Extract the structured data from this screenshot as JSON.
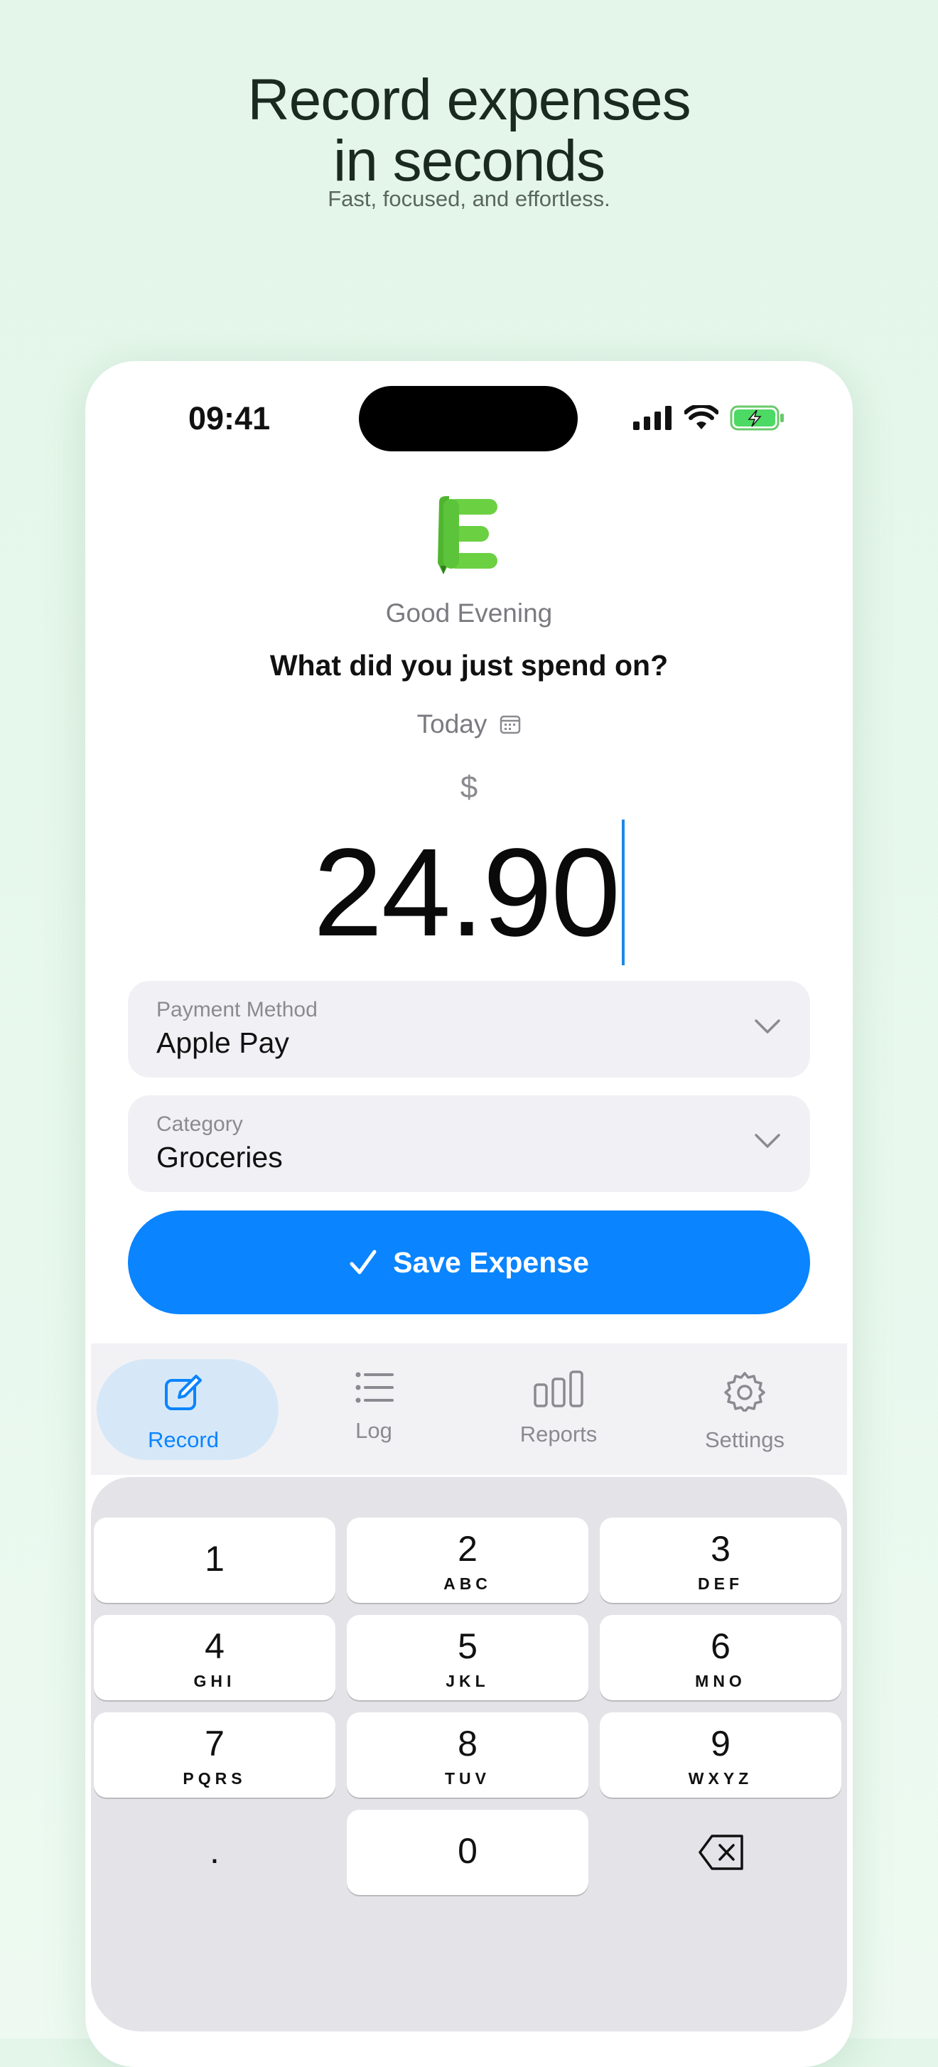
{
  "promo": {
    "headline_line1": "Record expenses",
    "headline_line2": "in seconds",
    "subheadline": "Fast, focused, and effortless."
  },
  "status_bar": {
    "time": "09:41"
  },
  "app": {
    "greeting": "Good Evening",
    "question": "What did you just spend on?",
    "date_label": "Today",
    "currency_symbol": "$",
    "amount": "24.90"
  },
  "fields": {
    "payment_method": {
      "label": "Payment Method",
      "value": "Apple Pay"
    },
    "category": {
      "label": "Category",
      "value": "Groceries"
    }
  },
  "save_button": {
    "label": "Save Expense"
  },
  "tabs": [
    {
      "label": "Record",
      "icon": "edit-icon",
      "active": true
    },
    {
      "label": "Log",
      "icon": "list-icon",
      "active": false
    },
    {
      "label": "Reports",
      "icon": "bar-chart-icon",
      "active": false
    },
    {
      "label": "Settings",
      "icon": "gear-icon",
      "active": false
    }
  ],
  "keypad": [
    {
      "num": "1",
      "letters": ""
    },
    {
      "num": "2",
      "letters": "ABC"
    },
    {
      "num": "3",
      "letters": "DEF"
    },
    {
      "num": "4",
      "letters": "GHI"
    },
    {
      "num": "5",
      "letters": "JKL"
    },
    {
      "num": "6",
      "letters": "MNO"
    },
    {
      "num": "7",
      "letters": "PQRS"
    },
    {
      "num": "8",
      "letters": "TUV"
    },
    {
      "num": "9",
      "letters": "WXYZ"
    },
    {
      "num": ".",
      "letters": ""
    },
    {
      "num": "0",
      "letters": ""
    }
  ],
  "colors": {
    "accent": "#0a84ff",
    "logo_green": "#5cc43a",
    "background": "#e3f6e9"
  }
}
